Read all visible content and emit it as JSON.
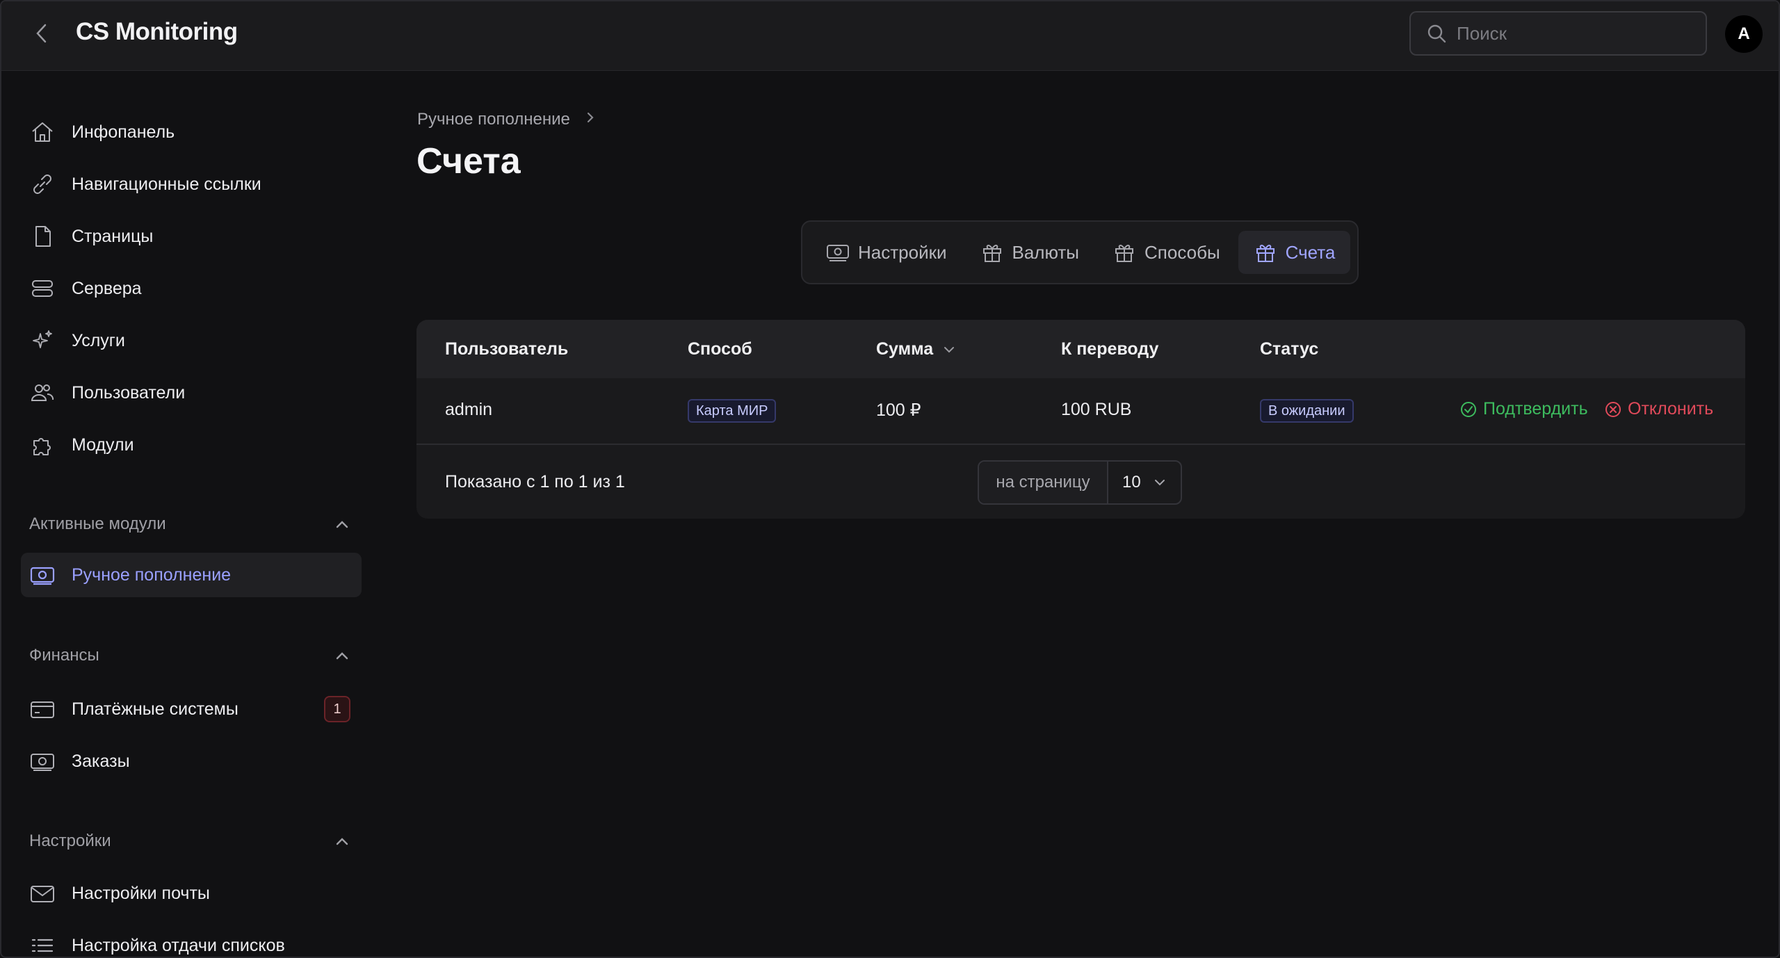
{
  "header": {
    "title": "CS Monitoring",
    "search_placeholder": "Поиск",
    "avatar_initial": "A"
  },
  "sidebar": {
    "items": [
      {
        "label": "Инфопанель",
        "icon": "home-icon"
      },
      {
        "label": "Навигационные ссылки",
        "icon": "link-icon"
      },
      {
        "label": "Страницы",
        "icon": "file-icon"
      },
      {
        "label": "Сервера",
        "icon": "server-icon"
      },
      {
        "label": "Услуги",
        "icon": "sparkle-icon"
      },
      {
        "label": "Пользователи",
        "icon": "users-icon"
      },
      {
        "label": "Модули",
        "icon": "puzzle-icon"
      }
    ],
    "sections": [
      {
        "title": "Активные модули",
        "items": [
          {
            "label": "Ручное пополнение",
            "icon": "money-icon",
            "active": true
          }
        ]
      },
      {
        "title": "Финансы",
        "items": [
          {
            "label": "Платёжные системы",
            "icon": "card-icon",
            "badge": "1"
          },
          {
            "label": "Заказы",
            "icon": "money-icon"
          }
        ]
      },
      {
        "title": "Настройки",
        "items": [
          {
            "label": "Настройки почты",
            "icon": "mail-icon"
          },
          {
            "label": "Настройка отдачи списков",
            "icon": "list-icon"
          }
        ]
      }
    ]
  },
  "main": {
    "breadcrumb": "Ручное пополнение",
    "title": "Счета",
    "tabs": [
      {
        "label": "Настройки",
        "icon": "money-icon",
        "active": false
      },
      {
        "label": "Валюты",
        "icon": "gift-icon",
        "active": false
      },
      {
        "label": "Способы",
        "icon": "gift-icon",
        "active": false
      },
      {
        "label": "Счета",
        "icon": "gift-icon",
        "active": true
      }
    ],
    "table": {
      "columns": [
        "Пользователь",
        "Способ",
        "Сумма",
        "К переводу",
        "Статус"
      ],
      "rows": [
        {
          "user": "admin",
          "method": "Карта МИР",
          "amount": "100 ₽",
          "transfer": "100 RUB",
          "status": "В ожидании",
          "confirm": "Подтвердить",
          "reject": "Отклонить"
        }
      ],
      "shown_text": "Показано с 1 по 1 из 1",
      "per_page_label": "на страницу",
      "per_page_value": "10"
    }
  },
  "colors": {
    "accent": "#9aa0ff",
    "confirm": "#3dbb5e",
    "reject": "#e04a5a",
    "background": "#111113"
  }
}
